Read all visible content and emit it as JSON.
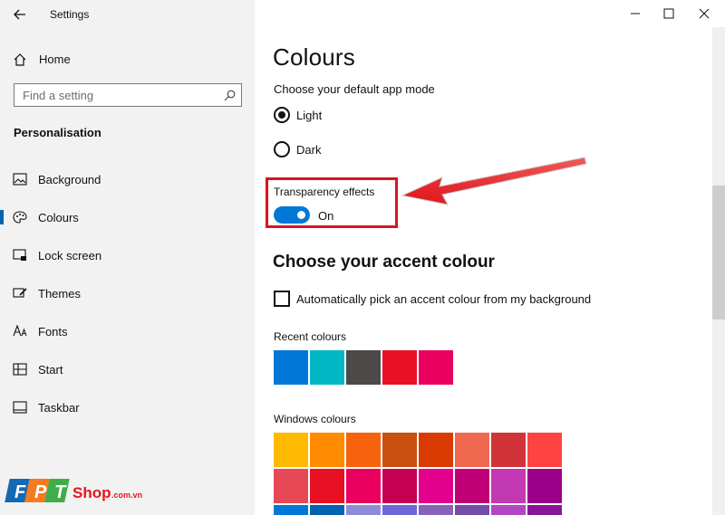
{
  "window": {
    "title": "Settings",
    "controls": {
      "minimize": "minimize-icon",
      "maximize": "maximize-icon",
      "close": "close-icon"
    }
  },
  "nav": {
    "home": "Home",
    "search_placeholder": "Find a setting",
    "section": "Personalisation",
    "items": [
      {
        "label": "Background",
        "icon": "picture-icon"
      },
      {
        "label": "Colours",
        "icon": "palette-icon",
        "active": true
      },
      {
        "label": "Lock screen",
        "icon": "lock-screen-icon"
      },
      {
        "label": "Themes",
        "icon": "brush-icon"
      },
      {
        "label": "Fonts",
        "icon": "font-icon"
      },
      {
        "label": "Start",
        "icon": "start-grid-icon"
      },
      {
        "label": "Taskbar",
        "icon": "taskbar-icon"
      }
    ]
  },
  "main": {
    "title": "Colours",
    "app_mode": {
      "label": "Choose your default app mode",
      "options": [
        {
          "label": "Light",
          "checked": true
        },
        {
          "label": "Dark",
          "checked": false
        }
      ]
    },
    "transparency": {
      "label": "Transparency effects",
      "state": "On",
      "enabled": true
    },
    "accent": {
      "heading": "Choose your accent colour",
      "auto_pick_label": "Automatically pick an accent colour from my background",
      "auto_pick_checked": false,
      "recent_label": "Recent colours",
      "recent_colours": [
        "#0078d7",
        "#00b7c3",
        "#4c4a48",
        "#e81123",
        "#ea005e"
      ],
      "windows_label": "Windows colours",
      "windows_colours": [
        [
          "#ffb900",
          "#ff8c00",
          "#f7630c",
          "#ca5010",
          "#da3b01",
          "#ef6950",
          "#d13438",
          "#ff4343"
        ],
        [
          "#e74856",
          "#e81123",
          "#ea005e",
          "#c30052",
          "#e3008c",
          "#bf0077",
          "#c239b3",
          "#9a0089"
        ],
        [
          "#0078d7",
          "#0063b1",
          "#8e8cd8",
          "#6b69d6",
          "#8764b8",
          "#744da9",
          "#b146c2",
          "#881798"
        ]
      ]
    }
  },
  "branding": {
    "logo_text": "FPT",
    "shop_text": "Shop",
    "domain_suffix": ".com.vn"
  },
  "colors": {
    "accent": "#0078d7",
    "callout": "#d8151c",
    "nav_bg": "#f2f2f2"
  }
}
